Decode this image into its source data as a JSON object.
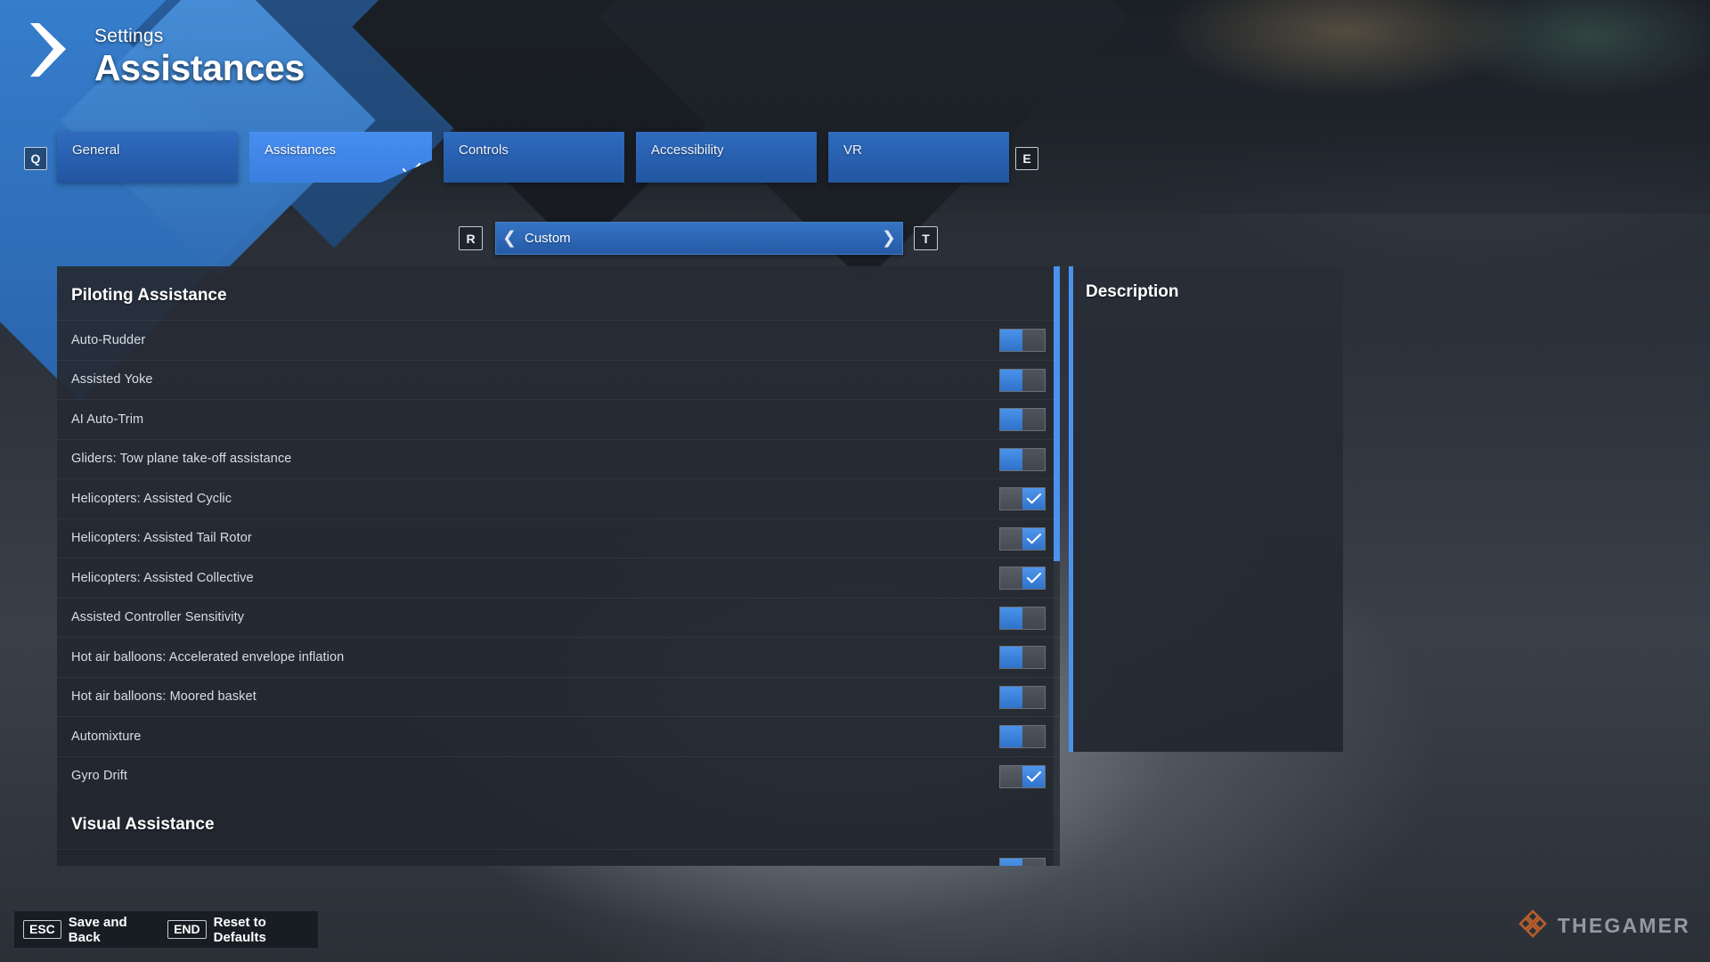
{
  "header": {
    "breadcrumb": "Settings",
    "title": "Assistances",
    "logo_icon": "chevron-right-logo"
  },
  "tabbar": {
    "prev_key": "Q",
    "next_key": "E",
    "tabs": [
      {
        "label": "General",
        "active": false
      },
      {
        "label": "Assistances",
        "active": true
      },
      {
        "label": "Controls",
        "active": false
      },
      {
        "label": "Accessibility",
        "active": false
      },
      {
        "label": "VR",
        "active": false
      }
    ],
    "active_check_icon": "check-icon"
  },
  "preset": {
    "left_key": "R",
    "right_key": "T",
    "value": "Custom",
    "prev_icon": "chevron-left-icon",
    "next_icon": "chevron-right-icon"
  },
  "settings": {
    "sections": [
      {
        "title": "Piloting Assistance",
        "rows": [
          {
            "label": "Auto-Rudder",
            "state": "off"
          },
          {
            "label": "Assisted Yoke",
            "state": "off"
          },
          {
            "label": "AI Auto-Trim",
            "state": "off"
          },
          {
            "label": "Gliders: Tow plane take-off assistance",
            "state": "off"
          },
          {
            "label": "Helicopters: Assisted Cyclic",
            "state": "on"
          },
          {
            "label": "Helicopters: Assisted Tail Rotor",
            "state": "on"
          },
          {
            "label": "Helicopters: Assisted Collective",
            "state": "on"
          },
          {
            "label": "Assisted Controller Sensitivity",
            "state": "off"
          },
          {
            "label": "Hot air balloons: Accelerated envelope inflation",
            "state": "off"
          },
          {
            "label": "Hot air balloons: Moored basket",
            "state": "off"
          },
          {
            "label": "Automixture",
            "state": "off"
          },
          {
            "label": "Gyro Drift",
            "state": "on"
          }
        ]
      },
      {
        "title": "Visual Assistance",
        "rows": [
          {
            "label": "",
            "state": "off"
          }
        ]
      }
    ]
  },
  "description": {
    "title": "Description",
    "body": ""
  },
  "footer": {
    "actions": [
      {
        "key": "ESC",
        "label": "Save and Back"
      },
      {
        "key": "END",
        "label": "Reset to Defaults"
      }
    ]
  },
  "brand": {
    "name": "THEGAMER",
    "logo_icon": "thegamer-diamond-icon"
  },
  "colors": {
    "accent_blue": "#4b92ef",
    "tab_blue": "#2f6bbf",
    "active_tab_blue": "#478ef0",
    "panel_dark": "#262b34",
    "text_primary": "#ffffff",
    "text_secondary": "#d8dee6",
    "brand_orange": "#c4622a"
  }
}
